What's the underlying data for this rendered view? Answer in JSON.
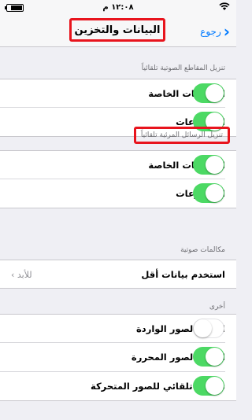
{
  "status_bar": {
    "time": "١٢:٠٨ م",
    "wifi_icon": "wifi-icon",
    "battery_icon": "battery-icon"
  },
  "nav": {
    "title": "البيانات والتخزين",
    "back_label": "رجوع",
    "back_icon": "chevron-right-icon"
  },
  "sections": [
    {
      "header": "تنزيل المقاطع الصوتية تلقائياً",
      "rows": [
        {
          "label": "المحادثات الخاصة",
          "toggle": true
        },
        {
          "label": "المجموعات",
          "toggle": true
        }
      ]
    },
    {
      "header": "تنزيل الرسائل المرئية تلقائياً",
      "rows": [
        {
          "label": "المحادثات الخاصة",
          "toggle": true
        },
        {
          "label": "المجموعات",
          "toggle": true
        }
      ]
    },
    {
      "header": "مكالمات صوتية",
      "rows": [
        {
          "label": "استخدم بيانات أقل",
          "value": "للأبد",
          "value_icon": "chevron-left-icon"
        }
      ]
    },
    {
      "header": "أخرى",
      "rows": [
        {
          "label": "احفظ الصور الواردة",
          "toggle": false
        },
        {
          "label": "احفظ الصور المحررة",
          "toggle": true
        },
        {
          "label": "تشغيل تلقائي للصور المتحركة",
          "toggle": true
        }
      ]
    }
  ],
  "colors": {
    "accent": "#007aff",
    "toggle_on": "#4cd964",
    "highlight": "#e8141d",
    "background": "#efeff4"
  }
}
